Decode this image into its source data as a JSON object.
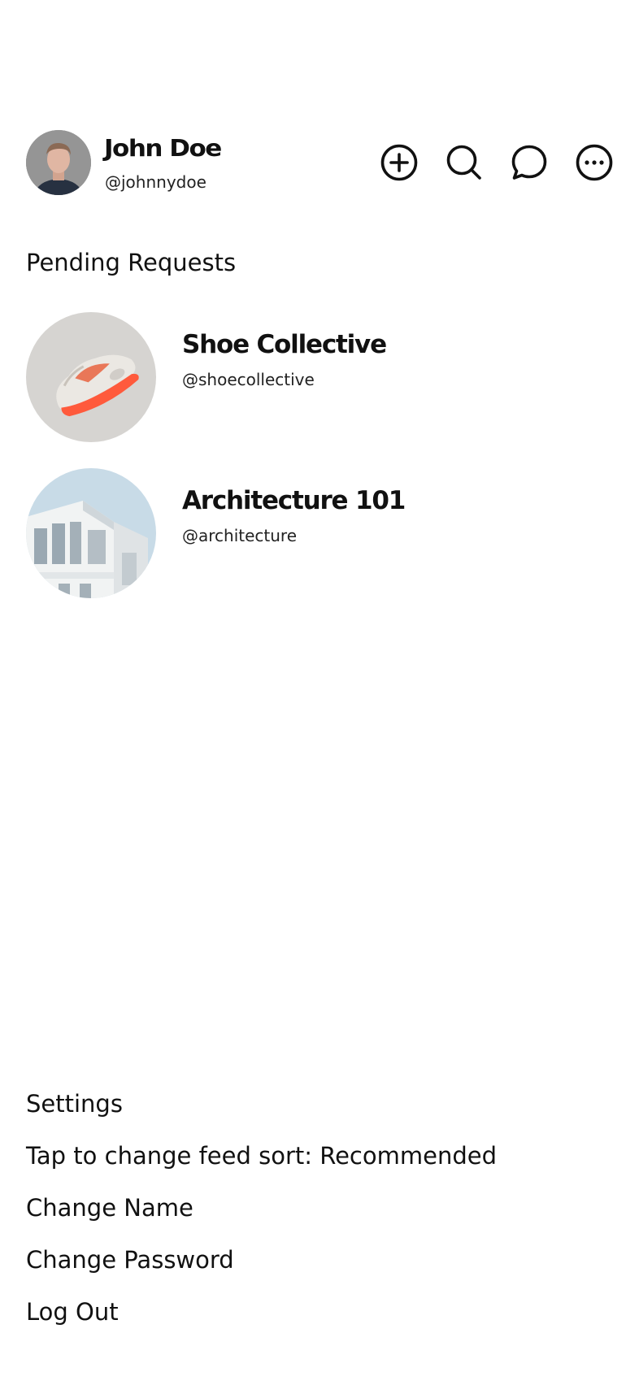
{
  "profile": {
    "name": "John Doe",
    "handle": "@johnnydoe",
    "avatar_icon": "user-avatar-photo"
  },
  "header_actions": [
    {
      "icon": "plus-circle-icon"
    },
    {
      "icon": "search-icon"
    },
    {
      "icon": "chat-bubble-icon"
    },
    {
      "icon": "more-horizontal-icon"
    }
  ],
  "pending": {
    "title": "Pending Requests",
    "items": [
      {
        "name": "Shoe Collective",
        "handle": "@shoecollective",
        "avatar_icon": "sneaker-photo"
      },
      {
        "name": "Architecture 101",
        "handle": "@architecture",
        "avatar_icon": "building-photo"
      }
    ]
  },
  "settings": {
    "title": "Settings",
    "feed_sort": "Tap to change feed sort: Recommended",
    "change_name": "Change Name",
    "change_password": "Change Password",
    "log_out": "Log Out"
  },
  "colors": {
    "text": "#111111",
    "background": "#ffffff",
    "shoe_accent": "#ff5a3c",
    "sky": "#c8dbe7"
  }
}
